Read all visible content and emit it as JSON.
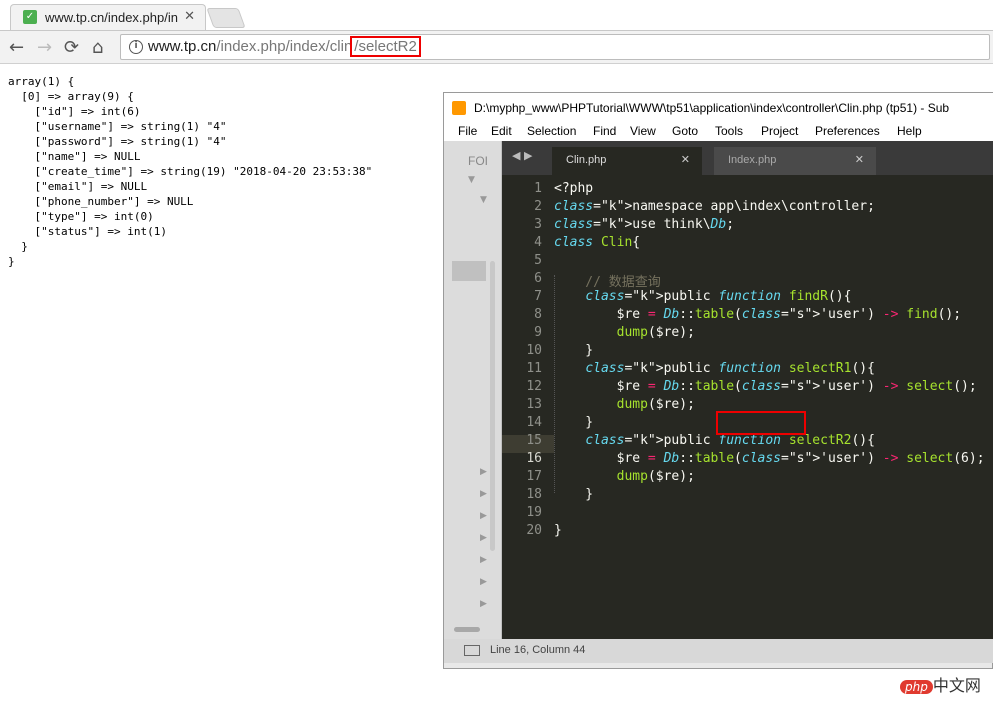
{
  "browser": {
    "tab_title": "www.tp.cn/index.php/in",
    "tab_close": "✕",
    "url_host": "www.tp.cn",
    "url_path": "/index.php/index/clin",
    "url_highlight": "/selectR2",
    "nav": {
      "back": "←",
      "forward": "→",
      "reload": "⟳",
      "home": "⌂",
      "info": "i"
    }
  },
  "dump_lines": [
    "array(1) {",
    "  [0] => array(9) {",
    "    [\"id\"] => int(6)",
    "    [\"username\"] => string(1) \"4\"",
    "    [\"password\"] => string(1) \"4\"",
    "    [\"name\"] => NULL",
    "    [\"create_time\"] => string(19) \"2018-04-20 23:53:38\"",
    "    [\"email\"] => NULL",
    "    [\"phone_number\"] => NULL",
    "    [\"type\"] => int(0)",
    "    [\"status\"] => int(1)",
    "  }",
    "}"
  ],
  "sublime": {
    "title": "D:\\myphp_www\\PHPTutorial\\WWW\\tp51\\application\\index\\controller\\Clin.php (tp51) - Sub",
    "menu": [
      "File",
      "Edit",
      "Selection",
      "Find",
      "View",
      "Goto",
      "Tools",
      "Project",
      "Preferences",
      "Help"
    ],
    "sidebar_label": "FOI",
    "tabs": [
      {
        "label": "Clin.php",
        "close": "✕"
      },
      {
        "label": "Index.php",
        "close": "✕"
      }
    ],
    "line_numbers": [
      "1",
      "2",
      "3",
      "4",
      "5",
      "6",
      "7",
      "8",
      "9",
      "10",
      "11",
      "12",
      "13",
      "14",
      "15",
      "16",
      "17",
      "18",
      "19",
      "20"
    ],
    "code_lines": [
      "<?php",
      "namespace app\\index\\controller;",
      "use think\\Db;",
      "class Clin{",
      "",
      "    // 数据查询",
      "    public function findR(){",
      "        $re = Db::table('user') -> find();",
      "        dump($re);",
      "    }",
      "    public function selectR1(){",
      "        $re = Db::table('user') -> select();",
      "        dump($re);",
      "    }",
      "    public function selectR2(){",
      "        $re = Db::table('user') -> select(6);",
      "        dump($re);",
      "    }",
      "",
      "}"
    ],
    "status": "Line 16, Column 44"
  },
  "watermark": {
    "logo": "php",
    "text": "中文网"
  }
}
